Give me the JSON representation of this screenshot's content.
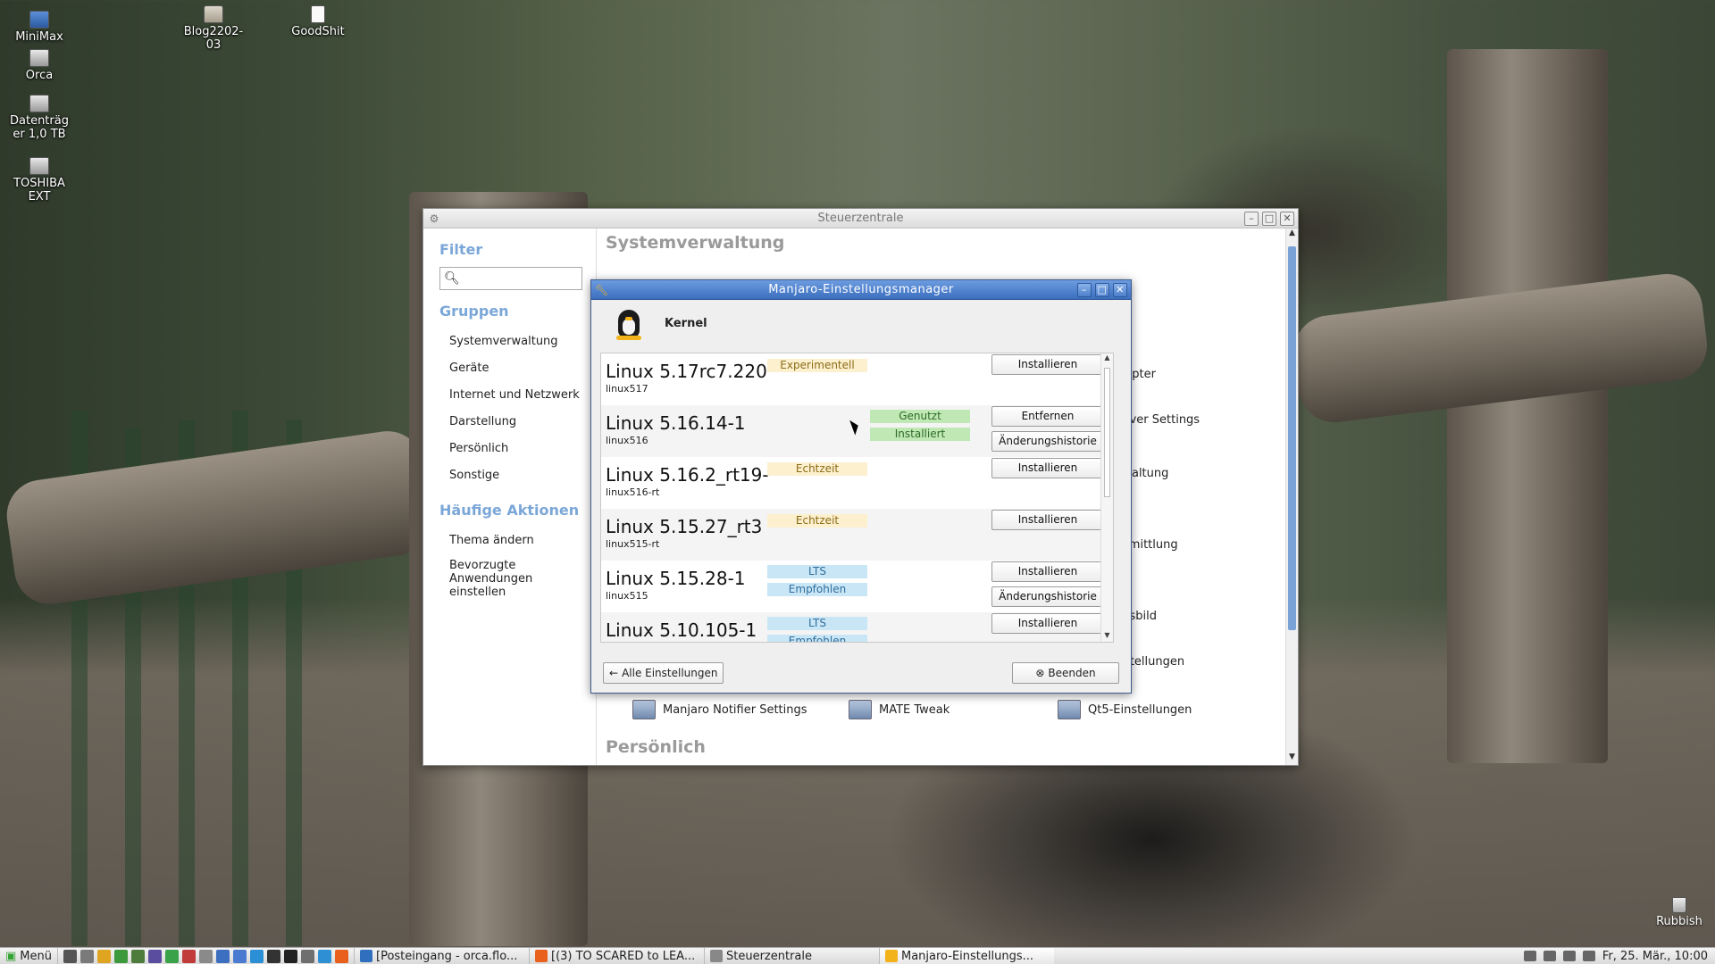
{
  "desktop": {
    "icons": [
      {
        "label": "MiniMax"
      },
      {
        "label": "Orca"
      },
      {
        "label": "Datenträg er 1,0 TB"
      },
      {
        "label": "TOSHIBA EXT"
      },
      {
        "label": "Blog2202-03"
      },
      {
        "label": "GoodShit"
      }
    ],
    "rubbish": "Rubbish"
  },
  "steuerzentrale": {
    "title": "Steuerzentrale",
    "filter_heading": "Filter",
    "search_icon": "search-icon",
    "groups_heading": "Gruppen",
    "groups": [
      "Systemverwaltung",
      "Geräte",
      "Internet und Netzwerk",
      "Darstellung",
      "Persönlich",
      "Sonstige"
    ],
    "actions_heading": "Häufige Aktionen",
    "actions": [
      "Thema ändern",
      "Bevorzugte Anwendungen einstellen"
    ],
    "section_title": "Systemverwaltung",
    "section_title_2": "Persönlich",
    "visible_items": [
      "-Adapter",
      "Server Settings",
      "erwaltung",
      "vermittlung",
      "ngsbild",
      "Einstellungen",
      "Manjaro Notifier Settings",
      "MATE Tweak",
      "Qt5-Einstellungen"
    ]
  },
  "manjaro": {
    "title": "Manjaro-Einstellungsmanager",
    "heading": "Kernel",
    "kernels": [
      {
        "name": "Linux 5.17rc7.220",
        "pkg": "linux517",
        "tags": [
          "Experimentell"
        ],
        "buttons": [
          "Installieren"
        ]
      },
      {
        "name": "Linux 5.16.14-1",
        "pkg": "linux516",
        "tags": [
          "Genutzt",
          "Installiert"
        ],
        "buttons": [
          "Entfernen",
          "Änderungshistorie"
        ]
      },
      {
        "name": "Linux 5.16.2_rt19-",
        "pkg": "linux516-rt",
        "tags": [
          "Echtzeit"
        ],
        "buttons": [
          "Installieren"
        ]
      },
      {
        "name": "Linux 5.15.27_rt3",
        "pkg": "linux515-rt",
        "tags": [
          "Echtzeit"
        ],
        "buttons": [
          "Installieren"
        ]
      },
      {
        "name": "Linux 5.15.28-1",
        "pkg": "linux515",
        "tags": [
          "LTS",
          "Empfohlen"
        ],
        "buttons": [
          "Installieren",
          "Änderungshistorie"
        ]
      },
      {
        "name": "Linux 5.10.105-1",
        "pkg": "",
        "tags": [
          "LTS",
          "Empfohlen"
        ],
        "buttons": [
          "Installieren"
        ]
      }
    ],
    "back_button": "Alle Einstellungen",
    "quit_button": "Beenden"
  },
  "taskbar": {
    "menu": "Menü",
    "tasks": [
      "[Posteingang - orca.flo...",
      "[(3) TO SCARED to LEA...",
      "Steuerzentrale",
      "Manjaro-Einstellungs..."
    ],
    "clock": "Fr, 25. Mär., 10:00"
  }
}
